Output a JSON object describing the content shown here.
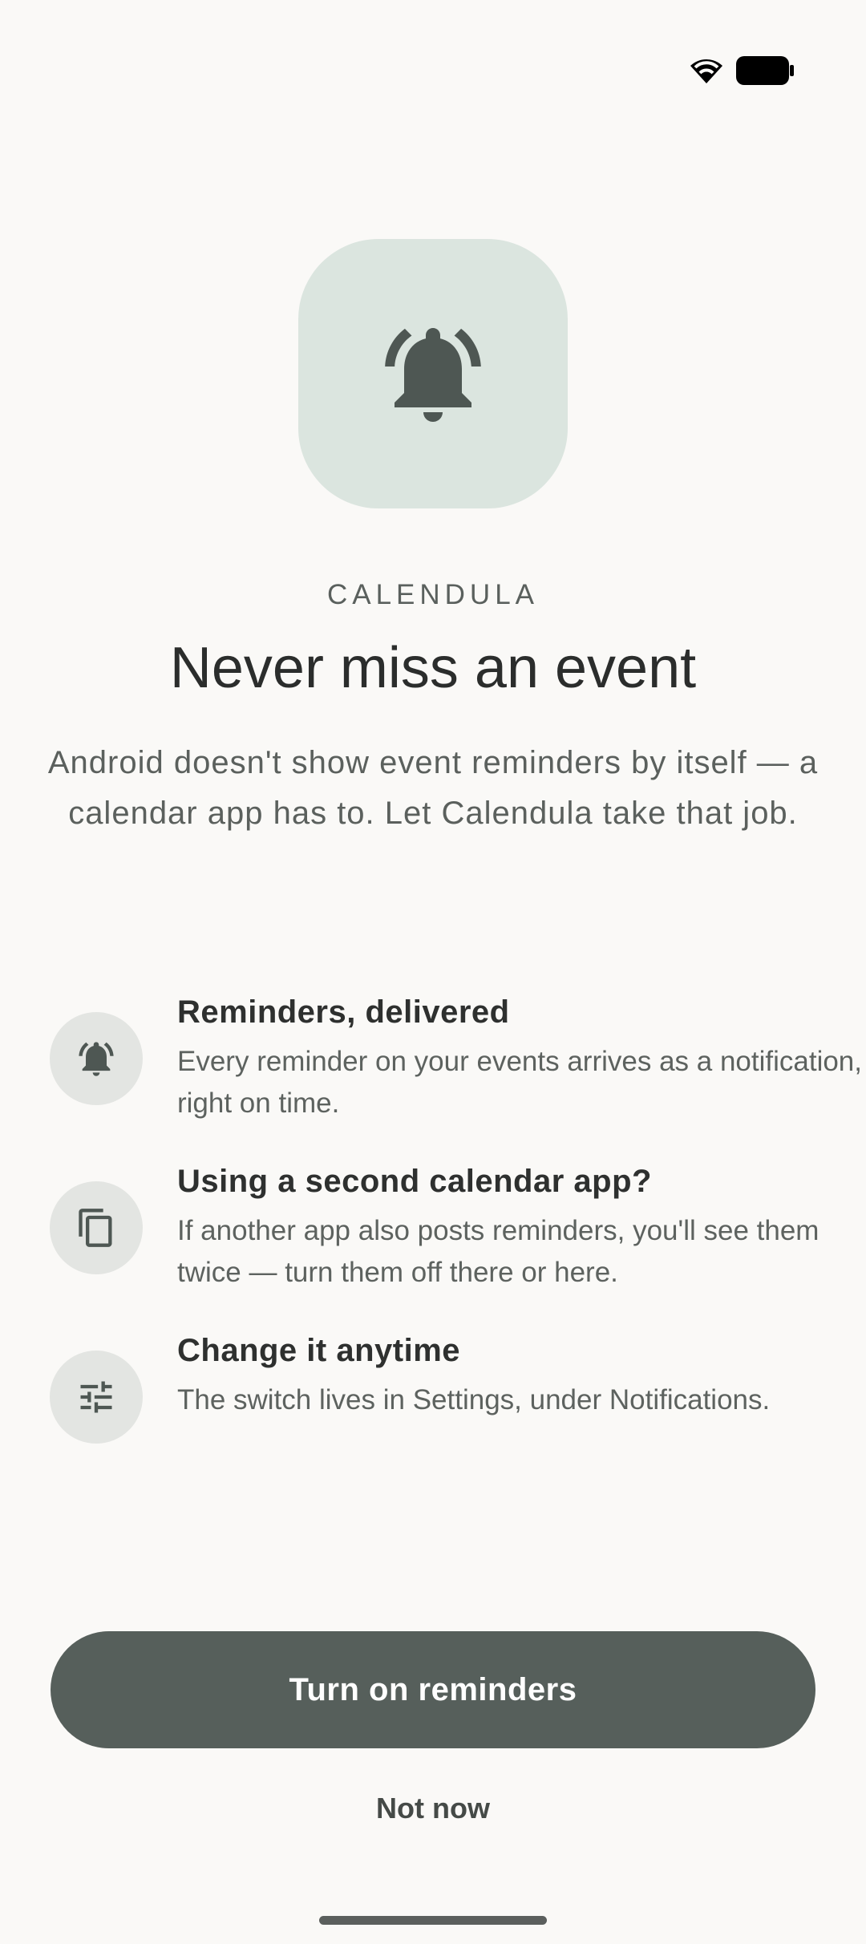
{
  "status_bar": {
    "icons": [
      "wifi-icon",
      "battery-icon"
    ]
  },
  "hero": {
    "icon": "bell-ringing-icon"
  },
  "brand": "CALENDULA",
  "headline": "Never miss an event",
  "intro": "Android doesn't show event reminders by itself — a calendar app has to. Let Calendula take that job.",
  "features": [
    {
      "icon": "bell-ringing-icon",
      "title": "Reminders, delivered",
      "description": "Every reminder on your events arrives as a notification, right on time."
    },
    {
      "icon": "copy-icon",
      "title": "Using a second calendar app?",
      "description": "If another app also posts reminders, you'll see them twice — turn them off there or here."
    },
    {
      "icon": "sliders-icon",
      "title": "Change it anytime",
      "description": "The switch lives in Settings, under Notifications."
    }
  ],
  "actions": {
    "primary_label": "Turn on reminders",
    "secondary_label": "Not now"
  },
  "colors": {
    "background": "#faf9f7",
    "hero_background": "#dbe5df",
    "icon_color": "#4e5753",
    "primary_button": "#565f5b",
    "feature_icon_background": "#e3e5e2"
  }
}
